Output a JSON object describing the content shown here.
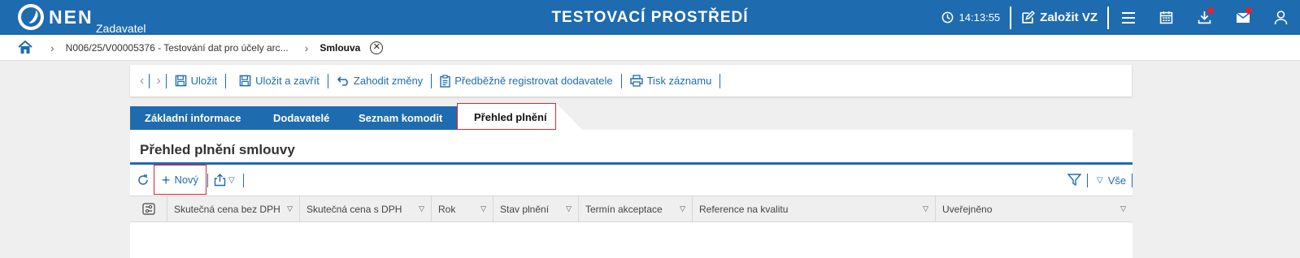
{
  "topbar": {
    "logo": "NEN",
    "logo_sub": "Zadavatel",
    "title": "TESTOVACÍ PROSTŘEDÍ",
    "time": "14:13:55",
    "create_label": "Založit VZ"
  },
  "breadcrumb": {
    "items": [
      "N006/25/V00005376 - Testování dat pro účely arc...",
      "Smlouva"
    ],
    "close_icon": "close-circle-icon"
  },
  "toolbar": {
    "save": "Uložit",
    "save_close": "Uložit a zavřít",
    "discard": "Zahodit změny",
    "preregister": "Předběžně registrovat dodavatele",
    "print": "Tisk záznamu"
  },
  "tabs": [
    "Základní informace",
    "Dodavatelé",
    "Seznam komodit",
    "Přehled plnění"
  ],
  "active_tab": "Přehled plnění",
  "panel": {
    "title": "Přehled plnění smlouvy",
    "new_label": "Nový",
    "filter_all": "Vše"
  },
  "table": {
    "columns": [
      "Skutečná cena bez DPH",
      "Skutečná cena s DPH",
      "Rok",
      "Stav plnění",
      "Termín akceptace",
      "Reference na kvalitu",
      "Uveřejněno"
    ],
    "rows": []
  },
  "colors": {
    "primary": "#1f6bb0",
    "highlight": "#e0242e",
    "background": "#efefef"
  }
}
